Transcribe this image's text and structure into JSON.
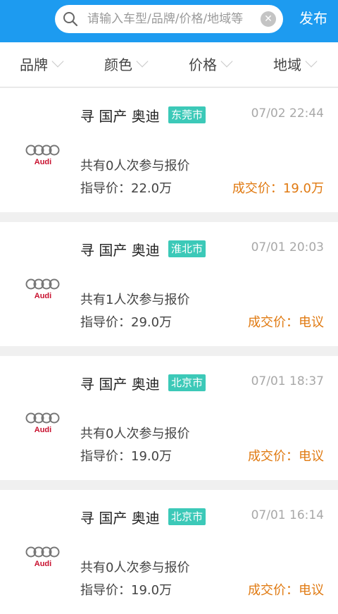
{
  "header": {
    "search_placeholder": "请输入车型/品牌/价格/地域等",
    "publish_label": "发布"
  },
  "filters": [
    {
      "label": "品牌"
    },
    {
      "label": "颜色"
    },
    {
      "label": "价格"
    },
    {
      "label": "地域"
    }
  ],
  "listings": [
    {
      "title": "寻 国产 奥迪",
      "city": "东莞市",
      "time": "07/02 22:44",
      "bidders": "共有0人次参与报价",
      "guide_price": "指导价：22.0万",
      "deal_price": "成交价：19.0万"
    },
    {
      "title": "寻 国产 奥迪",
      "city": "淮北市",
      "time": "07/01 20:03",
      "bidders": "共有1人次参与报价",
      "guide_price": "指导价：29.0万",
      "deal_price": "成交价：电议"
    },
    {
      "title": "寻 国产 奥迪",
      "city": "北京市",
      "time": "07/01 18:37",
      "bidders": "共有0人次参与报价",
      "guide_price": "指导价：19.0万",
      "deal_price": "成交价：电议"
    },
    {
      "title": "寻 国产 奥迪",
      "city": "北京市",
      "time": "07/01 16:14",
      "bidders": "共有0人次参与报价",
      "guide_price": "指导价：19.0万",
      "deal_price": "成交价：电议"
    }
  ],
  "colors": {
    "header_bg": "#1d9bf0",
    "city_tag_bg": "#3cc9b8",
    "deal_price": "#e07a12"
  },
  "brand_logo_text": "Audi"
}
